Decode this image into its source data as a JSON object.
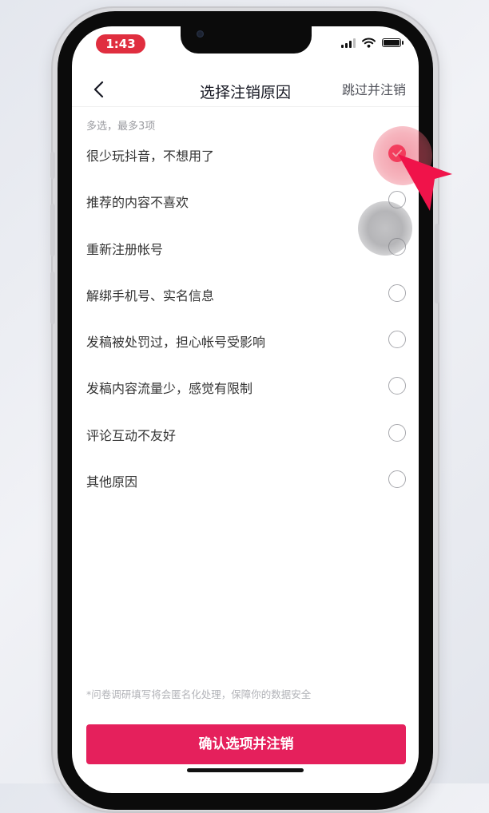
{
  "status_bar": {
    "time": "1:43"
  },
  "nav": {
    "title": "选择注销原因",
    "skip_label": "跳过并注销"
  },
  "hint": "多选，最多3项",
  "reasons": [
    {
      "label": "很少玩抖音，不想用了",
      "checked": true
    },
    {
      "label": "推荐的内容不喜欢",
      "checked": false
    },
    {
      "label": "重新注册帐号",
      "checked": false
    },
    {
      "label": "解绑手机号、实名信息",
      "checked": false
    },
    {
      "label": "发稿被处罚过，担心帐号受影响",
      "checked": false
    },
    {
      "label": "发稿内容流量少，感觉有限制",
      "checked": false
    },
    {
      "label": "评论互动不友好",
      "checked": false
    },
    {
      "label": "其他原因",
      "checked": false
    }
  ],
  "footnote": "*问卷调研填写将会匿名化处理，保障你的数据安全",
  "confirm_label": "确认选项并注销",
  "colors": {
    "accent": "#fe2c55",
    "button": "#e5205c",
    "time_pill": "#e02e3f"
  },
  "icons": [
    "back-arrow-icon",
    "signal-icon",
    "wifi-icon",
    "battery-icon",
    "checkmark-icon",
    "pointer-arrow-icon"
  ]
}
